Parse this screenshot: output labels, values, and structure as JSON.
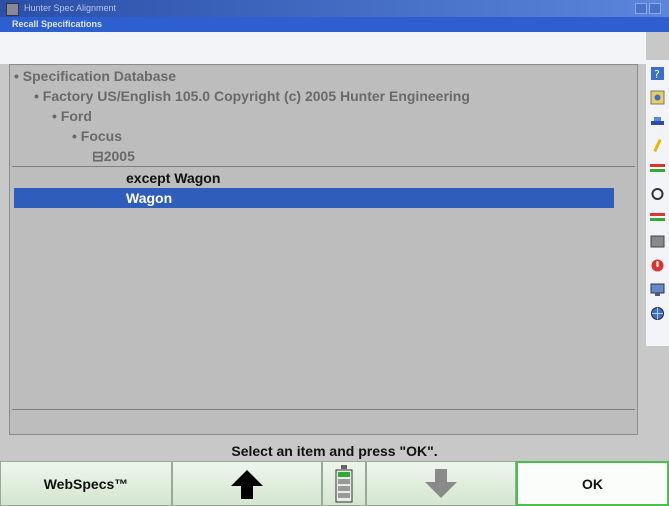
{
  "window": {
    "title": "Hunter Spec Alignment",
    "subtitle": "Recall Specifications"
  },
  "tree": {
    "items": [
      "• Specification Database",
      "• Factory US/English 105.0 Copyright (c) 2005 Hunter Engineering",
      "• Ford",
      "• Focus",
      "⊟2005"
    ]
  },
  "list": {
    "items": [
      {
        "label": "except Wagon",
        "selected": false
      },
      {
        "label": "Wagon",
        "selected": true
      }
    ]
  },
  "status": "Select an item and press \"OK\".",
  "fkeys": {
    "f1": "WebSpecs™",
    "f2_icon": "arrow-up-icon",
    "f3_icon": "list-scroll-icon",
    "f4_icon": "arrow-down-icon",
    "f5": "OK"
  },
  "colors": {
    "title_bar": "#2a4fa8",
    "selection": "#2f5dbb",
    "ok_border": "#4bbf4b"
  },
  "sidebar_icons": [
    "help-icon",
    "webspecs-icon",
    "vehicle-icon",
    "wrench-icon",
    "gauge-icon",
    "tool-icon",
    "bar-icon",
    "media-icon",
    "alert-icon",
    "monitor-icon",
    "globe-icon"
  ]
}
